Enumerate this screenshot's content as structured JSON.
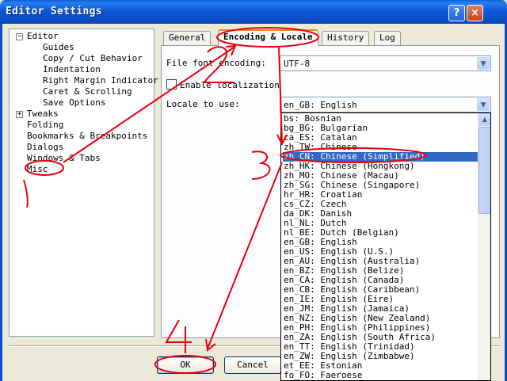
{
  "window": {
    "title": "Editor Settings",
    "help_glyph": "?",
    "close_glyph": "×"
  },
  "tree": {
    "items": [
      {
        "label": "Editor",
        "expander": "−"
      },
      {
        "label": "Guides"
      },
      {
        "label": "Copy / Cut Behavior"
      },
      {
        "label": "Indentation"
      },
      {
        "label": "Right Margin Indicator"
      },
      {
        "label": "Caret & Scrolling"
      },
      {
        "label": "Save Options"
      },
      {
        "label": "Tweaks",
        "expander": "+"
      },
      {
        "label": "Folding"
      },
      {
        "label": "Bookmarks & Breakpoints"
      },
      {
        "label": "Dialogs"
      },
      {
        "label": "Windows & Tabs"
      },
      {
        "label": "Misc"
      }
    ]
  },
  "tabs": [
    {
      "label": "General"
    },
    {
      "label": "Encoding & Locale",
      "active": true
    },
    {
      "label": "History"
    },
    {
      "label": "Log"
    }
  ],
  "panel": {
    "file_encoding_label": "File font encoding:",
    "file_encoding_value": "UTF-8",
    "enable_localization_label": "Enable localization",
    "enable_localization_checked": false,
    "locale_label": "Locale to use:",
    "locale_value": "en_GB: English"
  },
  "locale_list": {
    "selected_index": 4,
    "items": [
      "bs: Bosnian",
      "bg_BG: Bulgarian",
      "ca_ES: Catalan",
      "zh_TW: Chinese",
      "zh_CN: Chinese (Simplified)",
      "zh_HK: Chinese (Hongkong)",
      "zh_MO: Chinese (Macau)",
      "zh_SG: Chinese (Singapore)",
      "hr_HR: Croatian",
      "cs_CZ: Czech",
      "da_DK: Danish",
      "nl_NL: Dutch",
      "nl_BE: Dutch (Belgian)",
      "en_GB: English",
      "en_US: English (U.S.)",
      "en_AU: English (Australia)",
      "en_BZ: English (Belize)",
      "en_CA: English (Canada)",
      "en_CB: English (Caribbean)",
      "en_IE: English (Eire)",
      "en_JM: English (Jamaica)",
      "en_NZ: English (New Zealand)",
      "en_PH: English (Philippines)",
      "en_ZA: English (South Africa)",
      "en_TT: English (Trinidad)",
      "en_ZW: English (Zimbabwe)",
      "et_EE: Estonian",
      "fo_FO: Faeroese"
    ]
  },
  "buttons": {
    "ok": "OK",
    "cancel": "Cancel"
  },
  "annotations": {
    "color": "#e8000a",
    "step1": "1",
    "step2": "2",
    "step3": "3",
    "step4": "4"
  }
}
